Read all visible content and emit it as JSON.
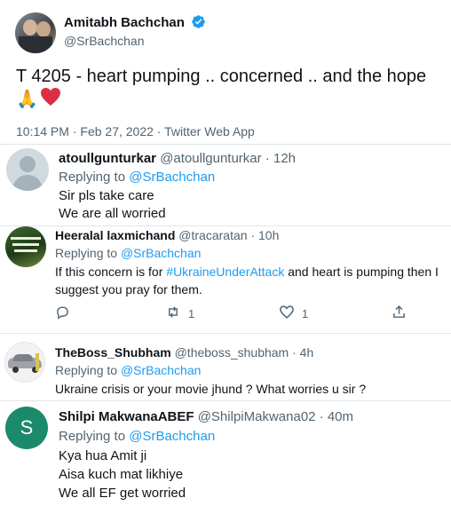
{
  "main_tweet": {
    "author_name": "Amitabh Bachchan",
    "author_handle": "@SrBachchan",
    "text": "T 4205 - heart pumping .. concerned .. and the hope",
    "emoji": "🙏",
    "time": "10:14 PM",
    "date": "Feb 27, 2022",
    "source": "Twitter Web App",
    "separator": "·"
  },
  "replies": [
    {
      "author_name": "atoullgunturkar",
      "author_handle": "@atoullgunturkar",
      "age": "12h",
      "replying_label": "Replying to",
      "replying_to": "@SrBachchan",
      "lines": [
        "Sir pls take care",
        "We are all worried"
      ]
    },
    {
      "author_name": "Heeralal laxmichand",
      "author_handle": "@tracaratan",
      "age": "10h",
      "replying_label": "Replying to",
      "replying_to": "@SrBachchan",
      "line1_pre": "If this concern is for ",
      "hashtag": "#UkraineUnderAttack",
      "line1_post": " and heart is pumping then I",
      "line2": "suggest you pray for them.",
      "actions": {
        "retweets": "1",
        "likes": "1"
      }
    },
    {
      "author_name": "TheBoss_Shubham",
      "author_handle": "@theboss_shubham",
      "age": "4h",
      "replying_label": "Replying to",
      "replying_to": "@SrBachchan",
      "lines": [
        "Ukraine crisis or your movie jhund ? What worries u sir ?"
      ]
    },
    {
      "author_name": "Shilpi MakwanaABEF",
      "author_handle": "@ShilpiMakwana02",
      "age": "40m",
      "avatar_letter": "S",
      "replying_label": "Replying to",
      "replying_to": "@SrBachchan",
      "lines": [
        "Kya hua Amit ji",
        "Aisa kuch mat likhiye",
        "We all EF get worried"
      ]
    }
  ]
}
